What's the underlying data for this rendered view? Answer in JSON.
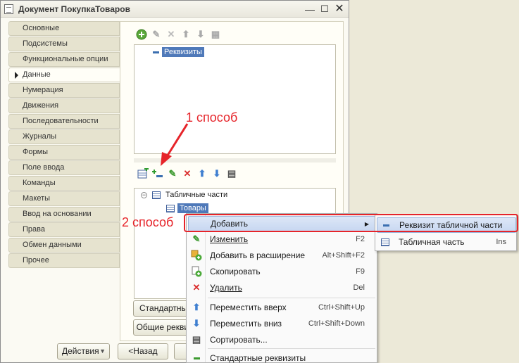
{
  "window": {
    "title": "Документ ПокупкаТоваров"
  },
  "tabs": [
    {
      "label": "Основные"
    },
    {
      "label": "Подсистемы"
    },
    {
      "label": "Функциональные опции"
    },
    {
      "label": "Данные",
      "active": true
    },
    {
      "label": "Нумерация"
    },
    {
      "label": "Движения"
    },
    {
      "label": "Последовательности"
    },
    {
      "label": "Журналы"
    },
    {
      "label": "Формы"
    },
    {
      "label": "Поле ввода"
    },
    {
      "label": "Команды"
    },
    {
      "label": "Макеты"
    },
    {
      "label": "Ввод на основании"
    },
    {
      "label": "Права"
    },
    {
      "label": "Обмен данными"
    },
    {
      "label": "Прочее"
    }
  ],
  "attributes_tree": {
    "root": "Реквизиты"
  },
  "tabular_tree": {
    "root": "Табличные части",
    "child": "Товары"
  },
  "annotations": {
    "way1": "1 способ",
    "way2": "2 способ"
  },
  "buttons": {
    "standard": "Стандартные реквизиты",
    "common": "Общие реквизиты",
    "actions": "Действия",
    "back": "<Назад"
  },
  "context_menu": {
    "items": [
      {
        "label": "Добавить",
        "shortcut": "",
        "icon": "none",
        "has_submenu": true
      },
      {
        "label": "Изменить",
        "shortcut": "F2",
        "icon": "pencil-icon"
      },
      {
        "label": "Добавить в расширение",
        "shortcut": "Alt+Shift+F2",
        "icon": "extension-add-icon"
      },
      {
        "label": "Скопировать",
        "shortcut": "F9",
        "icon": "copy-icon"
      },
      {
        "label": "Удалить",
        "shortcut": "Del",
        "icon": "delete-icon"
      },
      {
        "label": "Переместить вверх",
        "shortcut": "Ctrl+Shift+Up",
        "icon": "arrow-up-icon"
      },
      {
        "label": "Переместить вниз",
        "shortcut": "Ctrl+Shift+Down",
        "icon": "arrow-down-icon"
      },
      {
        "label": "Сортировать...",
        "shortcut": "",
        "icon": "sort-icon"
      },
      {
        "label": "Стандартные реквизиты",
        "shortcut": "",
        "icon": "minus-icon"
      }
    ]
  },
  "submenu": {
    "items": [
      {
        "label": "Реквизит табличной части",
        "shortcut": ""
      },
      {
        "label": "Табличная часть",
        "shortcut": "Ins"
      }
    ]
  },
  "colors": {
    "annotation": "#e6242a",
    "selection": "#4f79b9"
  }
}
